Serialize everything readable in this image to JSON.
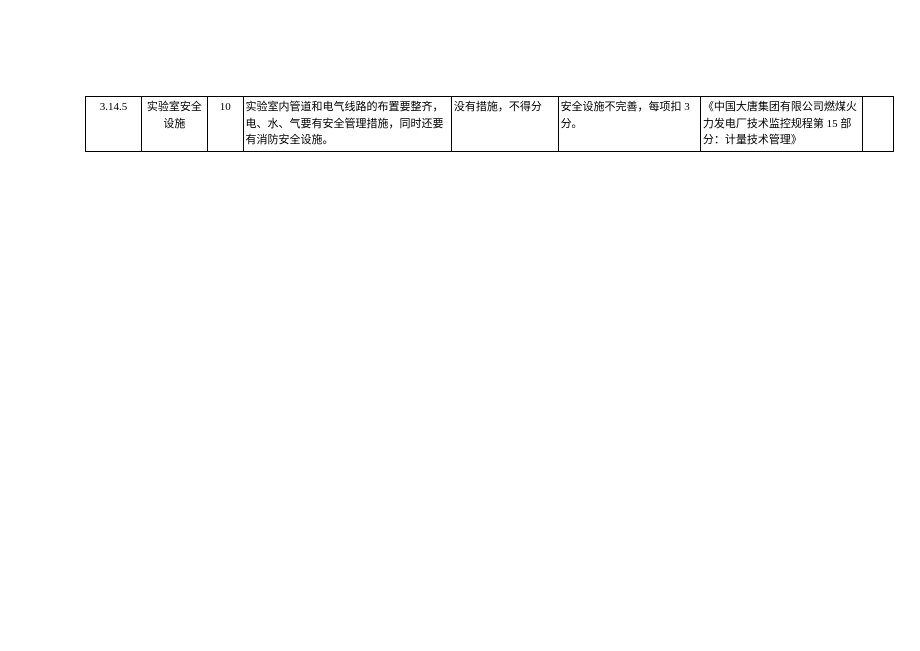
{
  "table": {
    "row": {
      "id": "3.14.5",
      "name": "实验室安全设施",
      "score": "10",
      "content": "实验室内管道和电气线路的布置要整齐，电、水、气要有安全管理措施，同时还要有消防安全设施。",
      "criteria1": "没有措施，不得分",
      "criteria2": "安全设施不完善，每项扣 3 分。",
      "reference": "《中国大唐集团有限公司燃煤火力发电厂技术监控规程第 15 部分：计量技术管理》",
      "last": ""
    }
  }
}
